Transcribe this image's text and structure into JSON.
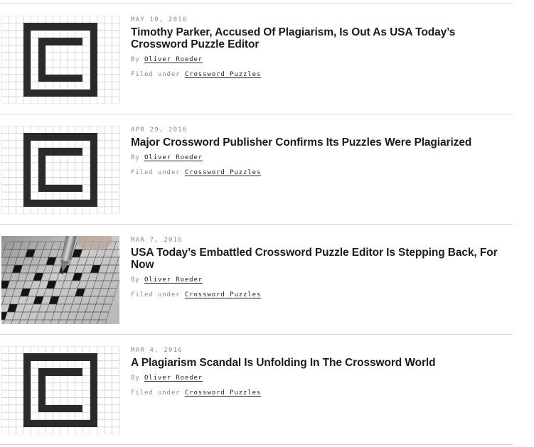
{
  "articles": [
    {
      "date": "MAY 10, 2016",
      "title": "Timothy Parker, Accused Of Plagiarism, Is Out As USA Today’s Crossword Puzzle Editor",
      "by_label": "By",
      "author": "Oliver Roeder",
      "filed_label": "Filed under",
      "category": "Crossword Puzzles",
      "thumbnail": "crossword-logo"
    },
    {
      "date": "APR 29, 2016",
      "title": "Major Crossword Publisher Confirms Its Puzzles Were Plagiarized",
      "by_label": "By",
      "author": "Oliver Roeder",
      "filed_label": "Filed under",
      "category": "Crossword Puzzles",
      "thumbnail": "crossword-logo"
    },
    {
      "date": "MAR 7, 2016",
      "title": "USA Today’s Embattled Crossword Puzzle Editor Is Stepping Back, For Now",
      "by_label": "By",
      "author": "Oliver Roeder",
      "filed_label": "Filed under",
      "category": "Crossword Puzzles",
      "thumbnail": "crossword-photo"
    },
    {
      "date": "MAR 4, 2016",
      "title": "A Plagiarism Scandal Is Unfolding In The Crossword World",
      "by_label": "By",
      "author": "Oliver Roeder",
      "filed_label": "Filed under",
      "category": "Crossword Puzzles",
      "thumbnail": "crossword-logo"
    }
  ]
}
